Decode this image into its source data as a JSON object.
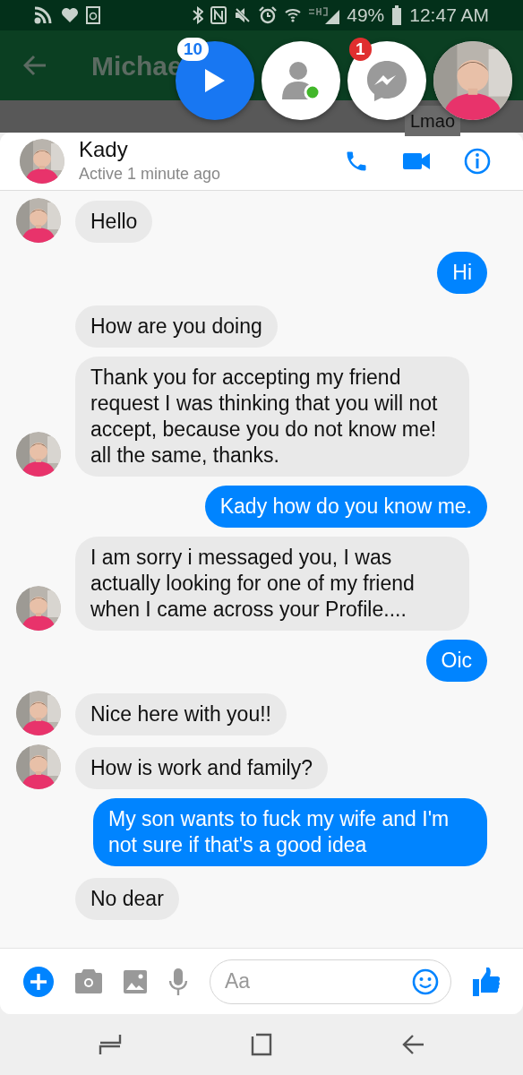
{
  "status_bar": {
    "battery": "49%",
    "time": "12:47 AM"
  },
  "app_bar": {
    "title": "Michae"
  },
  "chat_heads": [
    {
      "kind": "media",
      "badge": "10"
    },
    {
      "kind": "contacts"
    },
    {
      "kind": "messenger",
      "badge": "1"
    },
    {
      "kind": "profile",
      "tooltip": "Lmao"
    }
  ],
  "conversation": {
    "name": "Kady",
    "status": "Active 1 minute ago"
  },
  "messages": [
    {
      "kind": "incoming",
      "text": "Hello",
      "avatar": true
    },
    {
      "kind": "outgoing",
      "text": "Hi"
    },
    {
      "kind": "incoming",
      "text": "How are you doing",
      "avatar": false
    },
    {
      "kind": "incoming",
      "text": "Thank you for accepting my friend request I was thinking that you will not accept, because you do not know me! all the same, thanks.",
      "avatar": true
    },
    {
      "kind": "outgoing",
      "text": "Kady how do you know me."
    },
    {
      "kind": "incoming",
      "text": "I am sorry i messaged you, I was actually looking for one of my friend when I came across your Profile....",
      "avatar": true
    },
    {
      "kind": "outgoing",
      "text": "Oic"
    },
    {
      "kind": "incoming",
      "text": "Nice here with you!!",
      "avatar": true
    },
    {
      "kind": "incoming",
      "text": "How is work and family?",
      "avatar": true
    },
    {
      "kind": "outgoing",
      "text": "My son wants to fuck my wife and I'm not sure if that's a good idea"
    },
    {
      "kind": "incoming",
      "text": "No dear",
      "avatar": false
    }
  ],
  "composer": {
    "placeholder": "Aa"
  }
}
